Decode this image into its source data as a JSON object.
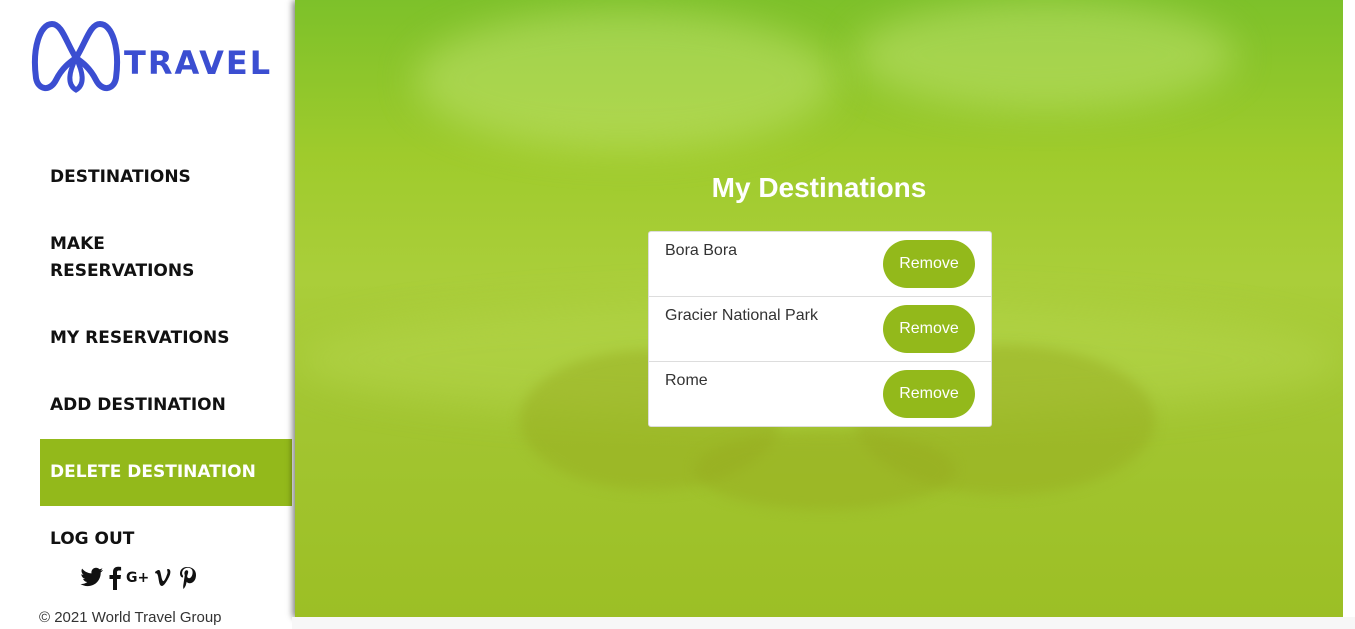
{
  "brand": {
    "logo_text": "TRAVEL",
    "accent_color": "#93b91b",
    "logo_color": "#3b4ed1"
  },
  "nav": {
    "items": [
      {
        "label": "DESTINATIONS"
      },
      {
        "label": "MAKE RESERVATIONS"
      },
      {
        "label": "MY RESERVATIONS"
      },
      {
        "label": "ADD DESTINATION"
      },
      {
        "label": "DELETE DESTINATION",
        "active": true
      },
      {
        "label": "LOG OUT"
      }
    ]
  },
  "social": {
    "icons": [
      "twitter-icon",
      "facebook-icon",
      "google-plus-icon",
      "vimeo-icon",
      "pinterest-icon"
    ],
    "labels": [
      "🐦",
      "f",
      "G+",
      "V",
      "P"
    ]
  },
  "footer": {
    "copyright": "© 2021 World Travel Group"
  },
  "main": {
    "heading": "My Destinations",
    "destinations": [
      {
        "name": "Bora Bora",
        "action": "Remove"
      },
      {
        "name": "Gracier National Park",
        "action": "Remove"
      },
      {
        "name": "Rome",
        "action": "Remove"
      }
    ]
  }
}
